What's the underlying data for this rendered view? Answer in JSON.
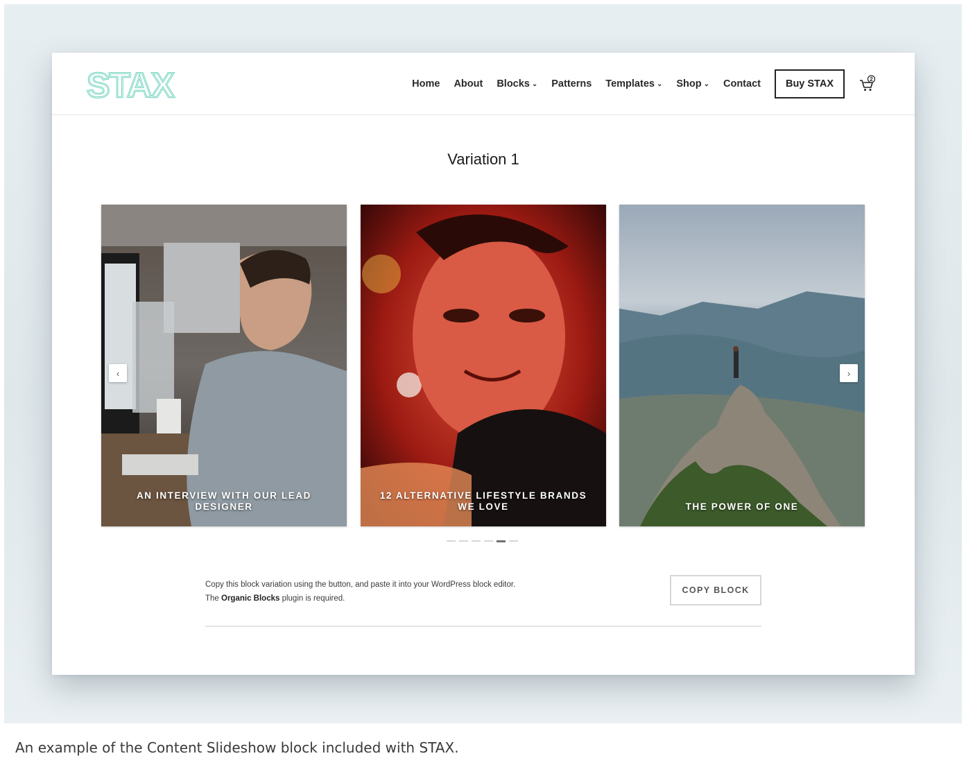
{
  "header": {
    "logo_text": "STAX",
    "nav": [
      {
        "label": "Home",
        "dropdown": false
      },
      {
        "label": "About",
        "dropdown": false
      },
      {
        "label": "Blocks",
        "dropdown": true
      },
      {
        "label": "Patterns",
        "dropdown": false
      },
      {
        "label": "Templates",
        "dropdown": true
      },
      {
        "label": "Shop",
        "dropdown": true
      },
      {
        "label": "Contact",
        "dropdown": false
      }
    ],
    "buy_button": "Buy STAX",
    "cart_count": "2",
    "cart_icon": "cart-icon"
  },
  "main": {
    "title": "Variation 1",
    "slides": [
      {
        "caption": "AN INTERVIEW WITH OUR LEAD DESIGNER"
      },
      {
        "caption": "12 ALTERNATIVE LIFESTYLE BRANDS WE LOVE"
      },
      {
        "caption": "THE POWER OF ONE"
      }
    ],
    "prev_arrow": "‹",
    "next_arrow": "›",
    "dots_count": 6,
    "active_dot": 4,
    "copy_line1": "Copy this block variation using the button, and paste it into your WordPress block editor.",
    "copy_line2_prefix": "The ",
    "copy_line2_bold": "Organic Blocks",
    "copy_line2_suffix": " plugin is required.",
    "copy_button": "COPY BLOCK"
  },
  "caption": "An example of the Content Slideshow block included with STAX.",
  "colors": {
    "logo": "#5fcfb5",
    "stage_bg": "#e3eaee",
    "text": "#2a2a2a"
  }
}
